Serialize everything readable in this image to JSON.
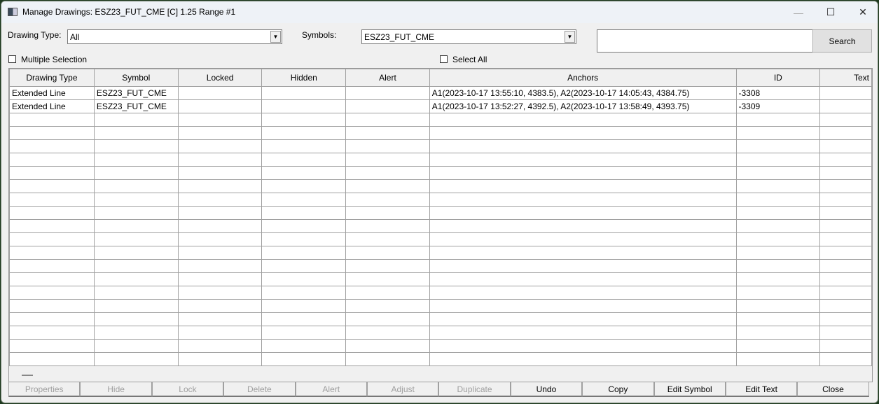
{
  "window": {
    "title": "Manage Drawings: ESZ23_FUT_CME [C]  1.25 Range #1",
    "minimize": "—",
    "maximize": "☐",
    "close": "✕"
  },
  "filters": {
    "drawing_type_label": "Drawing Type:",
    "drawing_type_value": "All",
    "symbols_label": "Symbols:",
    "symbols_value": "ESZ23_FUT_CME",
    "search_value": "",
    "search_button": "Search",
    "multiple_selection": "Multiple Selection",
    "select_all": "Select All"
  },
  "table": {
    "columns": [
      "Drawing Type",
      "Symbol",
      "Locked",
      "Hidden",
      "Alert",
      "Anchors",
      "ID",
      "Text"
    ],
    "rows": [
      [
        "Extended Line",
        "ESZ23_FUT_CME",
        "",
        "",
        "",
        "A1(2023-10-17  13:55:10, 4383.5), A2(2023-10-17  14:05:43, 4384.75)",
        "-3308",
        ""
      ],
      [
        "Extended Line",
        "ESZ23_FUT_CME",
        "",
        "",
        "",
        "A1(2023-10-17  13:52:27, 4392.5), A2(2023-10-17  13:58:49, 4393.75)",
        "-3309",
        ""
      ]
    ]
  },
  "buttons": [
    {
      "label": "Properties",
      "enabled": false
    },
    {
      "label": "Hide",
      "enabled": false
    },
    {
      "label": "Lock",
      "enabled": false
    },
    {
      "label": "Delete",
      "enabled": false
    },
    {
      "label": "Alert",
      "enabled": false
    },
    {
      "label": "Adjust",
      "enabled": false
    },
    {
      "label": "Duplicate",
      "enabled": false
    },
    {
      "label": "Undo",
      "enabled": true
    },
    {
      "label": "Copy",
      "enabled": true
    },
    {
      "label": "Edit Symbol",
      "enabled": true
    },
    {
      "label": "Edit Text",
      "enabled": true
    },
    {
      "label": "Close",
      "enabled": true
    }
  ]
}
